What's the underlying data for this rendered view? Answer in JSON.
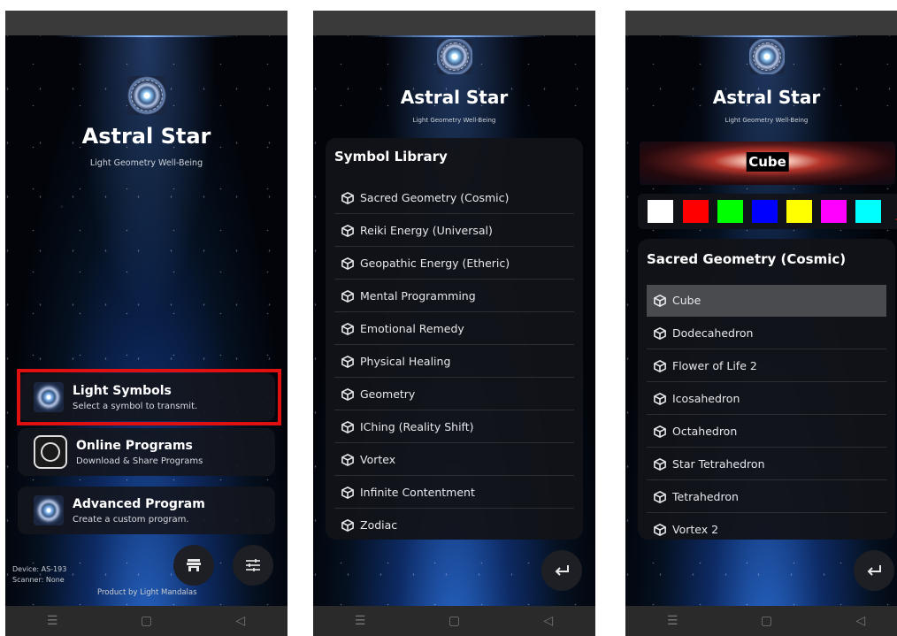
{
  "app": {
    "title": "Astral Star",
    "subtitle": "Light Geometry Well-Being"
  },
  "screen1": {
    "menu": [
      {
        "title": "Light Symbols",
        "subtitle": "Select a symbol to transmit.",
        "icon": "mandala-icon",
        "highlighted": true
      },
      {
        "title": "Online Programs",
        "subtitle": "Download & Share Programs",
        "icon": "frame-mandala-icon",
        "highlighted": false
      },
      {
        "title": "Advanced Program",
        "subtitle": "Create a custom program.",
        "icon": "mandala-icon",
        "highlighted": false
      }
    ],
    "device": "Device: AS-193",
    "scanner": "Scanner: None",
    "footer": "Product by Light Mandalas",
    "fab_left_icon": "store-icon",
    "fab_right_icon": "sliders-icon"
  },
  "screen2": {
    "panel_title": "Symbol Library",
    "items": [
      "Sacred Geometry (Cosmic)",
      "Reiki Energy (Universal)",
      "Geopathic Energy (Etheric)",
      "Mental Programming",
      "Emotional Remedy",
      "Physical Healing",
      "Geometry",
      "IChing (Reality Shift)",
      "Vortex",
      "Infinite Contentment",
      "Zodiac"
    ],
    "back_icon": "return-arrow-icon"
  },
  "screen3": {
    "preview_label": "Cube",
    "colors": [
      "#ffffff",
      "#ff0000",
      "#00ff00",
      "#0000ff",
      "#ffff00",
      "#ff00ff",
      "#00ffff"
    ],
    "selected_color_index": 6,
    "panel_title": "Sacred Geometry (Cosmic)",
    "items": [
      "Cube",
      "Dodecahedron",
      "Flower of Life 2",
      "Icosahedron",
      "Octahedron",
      "Star Tetrahedron",
      "Tetrahedron",
      "Vortex 2"
    ],
    "selected_item_index": 0,
    "back_icon": "return-arrow-icon"
  },
  "colors": {
    "highlight": "#e01010",
    "panel": "#121318",
    "selected_row": "#4a4b4f"
  }
}
